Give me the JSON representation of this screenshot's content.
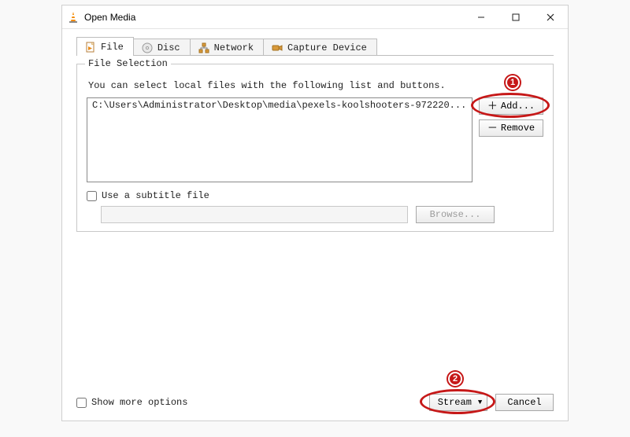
{
  "window": {
    "title": "Open Media"
  },
  "tabs": {
    "file": {
      "label": "File"
    },
    "disc": {
      "label": "Disc"
    },
    "network": {
      "label": "Network"
    },
    "capture": {
      "label": "Capture Device"
    }
  },
  "file_selection": {
    "legend": "File Selection",
    "hint": "You can select local files with the following list and buttons.",
    "files": [
      "C:\\Users\\Administrator\\Desktop\\media\\pexels-koolshooters-972220..."
    ],
    "add_label": "Add...",
    "remove_label": "Remove"
  },
  "subtitle": {
    "checkbox_label": "Use a subtitle file",
    "browse_label": "Browse...",
    "value": ""
  },
  "show_more": {
    "checkbox_label": "Show more options"
  },
  "buttons": {
    "stream_label": "Stream",
    "cancel_label": "Cancel"
  },
  "annotations": {
    "badge1": "1",
    "badge2": "2"
  }
}
